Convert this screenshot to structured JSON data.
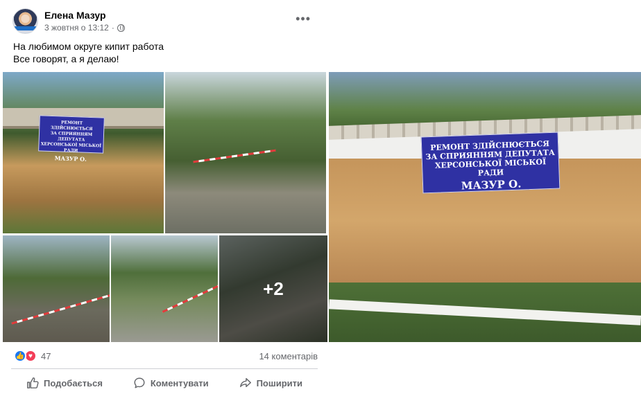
{
  "post": {
    "author": "Елена Мазур",
    "timestamp": "3 жовтня о 13:12",
    "privacy_icon": "globe-icon",
    "more_icon": "more-icon",
    "text_line1": "На любимом округе кипит работа",
    "text_line2": "Все говорят, а я делаю!"
  },
  "photos": {
    "sign_line1": "РЕМОНТ ЗДІЙСНЮЄТЬСЯ",
    "sign_line2": "ЗА СПРИЯННЯМ ДЕПУТАТА",
    "sign_line3": "ХЕРСОНСЬКОЇ МІСЬКОЇ РАДИ",
    "sign_line4": "МАЗУР О.",
    "more_count": "+2"
  },
  "stats": {
    "reaction_count": "47",
    "comments": "14 коментарів",
    "reaction_icons": [
      "like-icon",
      "love-icon"
    ]
  },
  "actions": {
    "like": "Подобається",
    "comment": "Коментувати",
    "share": "Поширити"
  },
  "colors": {
    "facebook_blue": "#1877f2",
    "love_red": "#f33e58",
    "secondary_text": "#65676b"
  }
}
